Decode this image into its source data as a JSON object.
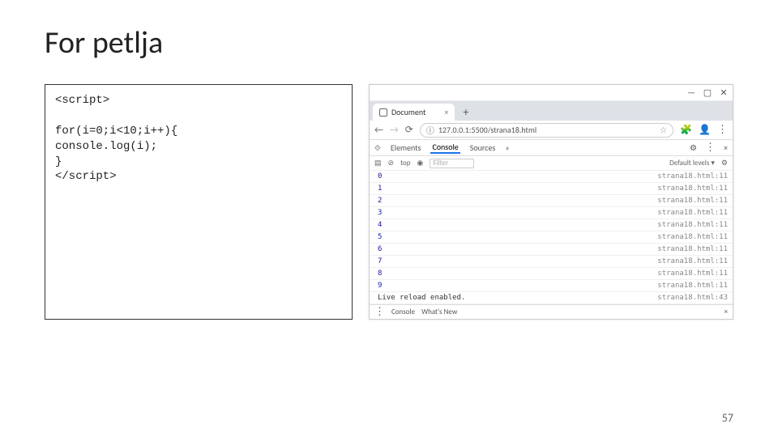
{
  "slide": {
    "title": "For petlja",
    "page_number": "57",
    "code": "<script>\n\nfor(i=0;i<10;i++){\nconsole.log(i);\n}\n</script>"
  },
  "browser": {
    "tab_title": "Document",
    "url": "127.0.0.1:5500/strana18.html",
    "devtools": {
      "tabs": [
        "Elements",
        "Console",
        "Sources"
      ],
      "context": "top",
      "filter_placeholder": "Filter",
      "levels": "Default levels ▾",
      "rows": [
        {
          "val": "0",
          "src": "strana18.html:11"
        },
        {
          "val": "1",
          "src": "strana18.html:11"
        },
        {
          "val": "2",
          "src": "strana18.html:11"
        },
        {
          "val": "3",
          "src": "strana18.html:11"
        },
        {
          "val": "4",
          "src": "strana18.html:11"
        },
        {
          "val": "5",
          "src": "strana18.html:11"
        },
        {
          "val": "6",
          "src": "strana18.html:11"
        },
        {
          "val": "7",
          "src": "strana18.html:11"
        },
        {
          "val": "8",
          "src": "strana18.html:11"
        },
        {
          "val": "9",
          "src": "strana18.html:11"
        },
        {
          "val": "Live reload enabled.",
          "src": "strana18.html:43"
        }
      ],
      "drawer_tabs": [
        "Console",
        "What's New"
      ]
    }
  }
}
